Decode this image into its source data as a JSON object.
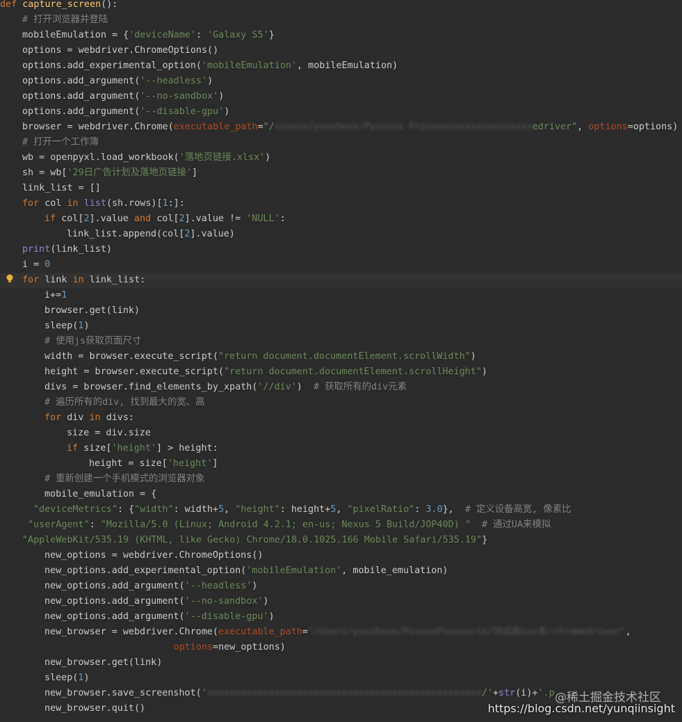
{
  "editor": {
    "lines": [
      {
        "indent": 0,
        "current": false,
        "tokens": [
          {
            "t": "def ",
            "c": "kw"
          },
          {
            "t": "capture_screen",
            "c": "fn"
          },
          {
            "t": "():",
            "c": "plain"
          }
        ]
      },
      {
        "indent": 1,
        "current": false,
        "tokens": [
          {
            "t": "# 打开浏览器并登陆",
            "c": "com"
          }
        ]
      },
      {
        "indent": 1,
        "current": false,
        "tokens": [
          {
            "t": "mobileEmulation = {",
            "c": "plain"
          },
          {
            "t": "'deviceName'",
            "c": "str"
          },
          {
            "t": ": ",
            "c": "plain"
          },
          {
            "t": "'Galaxy S5'",
            "c": "str"
          },
          {
            "t": "}",
            "c": "plain"
          }
        ]
      },
      {
        "indent": 1,
        "current": false,
        "tokens": [
          {
            "t": "options = webdriver.ChromeOptions()",
            "c": "plain"
          }
        ]
      },
      {
        "indent": 1,
        "current": false,
        "tokens": [
          {
            "t": "options.add_experimental_option(",
            "c": "plain"
          },
          {
            "t": "'mobileEmulation'",
            "c": "str"
          },
          {
            "t": ", mobileEmulation)",
            "c": "plain"
          }
        ]
      },
      {
        "indent": 1,
        "current": false,
        "tokens": [
          {
            "t": "options.add_argument(",
            "c": "plain"
          },
          {
            "t": "'--headless'",
            "c": "str"
          },
          {
            "t": ")",
            "c": "plain"
          }
        ]
      },
      {
        "indent": 1,
        "current": false,
        "tokens": [
          {
            "t": "options.add_argument(",
            "c": "plain"
          },
          {
            "t": "'--no-sandbox'",
            "c": "str"
          },
          {
            "t": ")",
            "c": "plain"
          }
        ]
      },
      {
        "indent": 1,
        "current": false,
        "tokens": [
          {
            "t": "options.add_argument(",
            "c": "plain"
          },
          {
            "t": "'--disable-gpu'",
            "c": "str"
          },
          {
            "t": ")",
            "c": "plain"
          }
        ]
      },
      {
        "indent": 1,
        "current": false,
        "tokens": [
          {
            "t": "browser = webdriver.Chrome(",
            "c": "plain"
          },
          {
            "t": "executable_path",
            "c": "param"
          },
          {
            "t": "=",
            "c": "plain"
          },
          {
            "t": "\"/",
            "c": "str"
          },
          {
            "t": "xxxxxx/yxxxhexx/Pyxxxxx Proxxxxxxxxxxxxxxxxxxx",
            "c": "blur"
          },
          {
            "t": "edriver\"",
            "c": "str"
          },
          {
            "t": ", ",
            "c": "plain"
          },
          {
            "t": "options",
            "c": "param"
          },
          {
            "t": "=options)",
            "c": "plain"
          }
        ]
      },
      {
        "indent": 1,
        "current": false,
        "tokens": [
          {
            "t": "# 打开一个工作簿",
            "c": "com"
          }
        ]
      },
      {
        "indent": 1,
        "current": false,
        "tokens": [
          {
            "t": "wb = openpyxl.load_workbook(",
            "c": "plain"
          },
          {
            "t": "'落地页链接.xlsx'",
            "c": "str"
          },
          {
            "t": ")",
            "c": "plain"
          }
        ]
      },
      {
        "indent": 1,
        "current": false,
        "tokens": [
          {
            "t": "sh = wb[",
            "c": "plain"
          },
          {
            "t": "'29日广告计划及落地页链接'",
            "c": "str"
          },
          {
            "t": "]",
            "c": "plain"
          }
        ]
      },
      {
        "indent": 1,
        "current": false,
        "tokens": [
          {
            "t": "link_list = []",
            "c": "plain"
          }
        ]
      },
      {
        "indent": 1,
        "current": false,
        "tokens": [
          {
            "t": "for ",
            "c": "kw"
          },
          {
            "t": "col ",
            "c": "plain"
          },
          {
            "t": "in ",
            "c": "kw"
          },
          {
            "t": "list",
            "c": "builtin"
          },
          {
            "t": "(sh.rows)[",
            "c": "plain"
          },
          {
            "t": "1",
            "c": "num"
          },
          {
            "t": ":]:",
            "c": "plain"
          }
        ]
      },
      {
        "indent": 2,
        "current": false,
        "tokens": [
          {
            "t": "if ",
            "c": "kw"
          },
          {
            "t": "col[",
            "c": "plain"
          },
          {
            "t": "2",
            "c": "num"
          },
          {
            "t": "].value ",
            "c": "plain"
          },
          {
            "t": "and ",
            "c": "kw"
          },
          {
            "t": "col[",
            "c": "plain"
          },
          {
            "t": "2",
            "c": "num"
          },
          {
            "t": "].value != ",
            "c": "plain"
          },
          {
            "t": "'NULL'",
            "c": "str"
          },
          {
            "t": ":",
            "c": "plain"
          }
        ]
      },
      {
        "indent": 3,
        "current": false,
        "tokens": [
          {
            "t": "link_list.append(col[",
            "c": "plain"
          },
          {
            "t": "2",
            "c": "num"
          },
          {
            "t": "].value)",
            "c": "plain"
          }
        ]
      },
      {
        "indent": 1,
        "current": false,
        "tokens": [
          {
            "t": "print",
            "c": "builtin"
          },
          {
            "t": "(link_list)",
            "c": "plain"
          }
        ]
      },
      {
        "indent": 1,
        "current": false,
        "tokens": [
          {
            "t": "i = ",
            "c": "plain"
          },
          {
            "t": "0",
            "c": "num"
          }
        ]
      },
      {
        "indent": 1,
        "current": true,
        "tokens": [
          {
            "t": "for ",
            "c": "kw"
          },
          {
            "t": "link ",
            "c": "plain"
          },
          {
            "t": "in ",
            "c": "kw"
          },
          {
            "t": "link_list:",
            "c": "plain"
          }
        ]
      },
      {
        "indent": 2,
        "current": false,
        "tokens": [
          {
            "t": "i+=",
            "c": "plain"
          },
          {
            "t": "1",
            "c": "num"
          }
        ]
      },
      {
        "indent": 2,
        "current": false,
        "tokens": [
          {
            "t": "browser.get(link)",
            "c": "plain"
          }
        ]
      },
      {
        "indent": 2,
        "current": false,
        "tokens": [
          {
            "t": "sleep(",
            "c": "plain"
          },
          {
            "t": "1",
            "c": "num"
          },
          {
            "t": ")",
            "c": "plain"
          }
        ]
      },
      {
        "indent": 2,
        "current": false,
        "tokens": [
          {
            "t": "# 使用js获取页面尺寸",
            "c": "com"
          }
        ]
      },
      {
        "indent": 2,
        "current": false,
        "tokens": [
          {
            "t": "width = browser.execute_script(",
            "c": "plain"
          },
          {
            "t": "\"return document.documentElement.scrollWidth\"",
            "c": "str"
          },
          {
            "t": ")",
            "c": "plain"
          }
        ]
      },
      {
        "indent": 2,
        "current": false,
        "tokens": [
          {
            "t": "height = browser.execute_script(",
            "c": "plain"
          },
          {
            "t": "\"return document.documentElement.scrollHeight\"",
            "c": "str"
          },
          {
            "t": ")",
            "c": "plain"
          }
        ]
      },
      {
        "indent": 2,
        "current": false,
        "tokens": [
          {
            "t": "divs = browser.find_elements_by_xpath(",
            "c": "plain"
          },
          {
            "t": "'//div'",
            "c": "str"
          },
          {
            "t": ")  ",
            "c": "plain"
          },
          {
            "t": "# 获取所有的div元素",
            "c": "com"
          }
        ]
      },
      {
        "indent": 2,
        "current": false,
        "tokens": [
          {
            "t": "# 遍历所有的div, 找到最大的宽、高",
            "c": "com"
          }
        ]
      },
      {
        "indent": 2,
        "current": false,
        "tokens": [
          {
            "t": "for ",
            "c": "kw"
          },
          {
            "t": "div ",
            "c": "plain"
          },
          {
            "t": "in ",
            "c": "kw"
          },
          {
            "t": "divs:",
            "c": "plain"
          }
        ]
      },
      {
        "indent": 3,
        "current": false,
        "tokens": [
          {
            "t": "size = div.size",
            "c": "plain"
          }
        ]
      },
      {
        "indent": 3,
        "current": false,
        "tokens": [
          {
            "t": "if ",
            "c": "kw"
          },
          {
            "t": "size[",
            "c": "plain"
          },
          {
            "t": "'height'",
            "c": "str"
          },
          {
            "t": "] > height:",
            "c": "plain"
          }
        ]
      },
      {
        "indent": 4,
        "current": false,
        "tokens": [
          {
            "t": "height = size[",
            "c": "plain"
          },
          {
            "t": "'height'",
            "c": "str"
          },
          {
            "t": "]",
            "c": "plain"
          }
        ]
      },
      {
        "indent": 2,
        "current": false,
        "tokens": [
          {
            "t": "# 重新创建一个手机模式的浏览器对象",
            "c": "com"
          }
        ]
      },
      {
        "indent": 2,
        "current": false,
        "tokens": [
          {
            "t": "mobile_emulation = {",
            "c": "plain"
          }
        ]
      },
      {
        "indent": 1.5,
        "current": false,
        "tokens": [
          {
            "t": "\"deviceMetrics\"",
            "c": "str"
          },
          {
            "t": ": {",
            "c": "plain"
          },
          {
            "t": "\"width\"",
            "c": "str"
          },
          {
            "t": ": width+",
            "c": "plain"
          },
          {
            "t": "5",
            "c": "num"
          },
          {
            "t": ", ",
            "c": "plain"
          },
          {
            "t": "\"height\"",
            "c": "str"
          },
          {
            "t": ": height+",
            "c": "plain"
          },
          {
            "t": "5",
            "c": "num"
          },
          {
            "t": ", ",
            "c": "plain"
          },
          {
            "t": "\"pixelRatio\"",
            "c": "str"
          },
          {
            "t": ": ",
            "c": "plain"
          },
          {
            "t": "3.0",
            "c": "num"
          },
          {
            "t": "},  ",
            "c": "plain"
          },
          {
            "t": "# 定义设备高宽, 像素比",
            "c": "com"
          }
        ]
      },
      {
        "indent": 1.25,
        "current": false,
        "tokens": [
          {
            "t": "\"userAgent\"",
            "c": "str"
          },
          {
            "t": ": ",
            "c": "plain"
          },
          {
            "t": "\"Mozilla/5.0 (Linux; Android 4.2.1; en-us; Nexus 5 Build/JOP40D) \"",
            "c": "str"
          },
          {
            "t": "  ",
            "c": "plain"
          },
          {
            "t": "# 通过UA来模拟",
            "c": "com"
          }
        ]
      },
      {
        "indent": 1,
        "current": false,
        "tokens": [
          {
            "t": "\"AppleWebKit/535.19 (KHTML, like Gecko) Chrome/18.0.1025.166 Mobile Safari/535.19\"",
            "c": "str"
          },
          {
            "t": "}",
            "c": "plain"
          }
        ]
      },
      {
        "indent": 2,
        "current": false,
        "tokens": [
          {
            "t": "new_options = webdriver.ChromeOptions()",
            "c": "plain"
          }
        ]
      },
      {
        "indent": 2,
        "current": false,
        "tokens": [
          {
            "t": "new_options.add_experimental_option(",
            "c": "plain"
          },
          {
            "t": "'mobileEmulation'",
            "c": "str"
          },
          {
            "t": ", mobile_emulation)",
            "c": "plain"
          }
        ]
      },
      {
        "indent": 2,
        "current": false,
        "tokens": [
          {
            "t": "new_options.add_argument(",
            "c": "plain"
          },
          {
            "t": "'--headless'",
            "c": "str"
          },
          {
            "t": ")",
            "c": "plain"
          }
        ]
      },
      {
        "indent": 2,
        "current": false,
        "tokens": [
          {
            "t": "new_options.add_argument(",
            "c": "plain"
          },
          {
            "t": "'--no-sandbox'",
            "c": "str"
          },
          {
            "t": ")",
            "c": "plain"
          }
        ]
      },
      {
        "indent": 2,
        "current": false,
        "tokens": [
          {
            "t": "new_options.add_argument(",
            "c": "plain"
          },
          {
            "t": "'--disable-gpu'",
            "c": "str"
          },
          {
            "t": ")",
            "c": "plain"
          }
        ]
      },
      {
        "indent": 2,
        "current": false,
        "tokens": [
          {
            "t": "new_browser = webdriver.Chrome(",
            "c": "plain"
          },
          {
            "t": "executable_path",
            "c": "param"
          },
          {
            "t": "=",
            "c": "plain"
          },
          {
            "t": "\"/Users/yxxzhxxx/PxxxxxPxxxxxcts/测试用xxx本/chromedriver\"",
            "c": "blur"
          },
          {
            "t": ",",
            "c": "plain"
          }
        ]
      },
      {
        "indent": 7.8,
        "current": false,
        "tokens": [
          {
            "t": "options",
            "c": "param"
          },
          {
            "t": "=new_options)",
            "c": "plain"
          }
        ]
      },
      {
        "indent": 2,
        "current": false,
        "tokens": [
          {
            "t": "new_browser.get(link)",
            "c": "plain"
          }
        ]
      },
      {
        "indent": 2,
        "current": false,
        "tokens": [
          {
            "t": "sleep(",
            "c": "plain"
          },
          {
            "t": "1",
            "c": "num"
          },
          {
            "t": ")",
            "c": "plain"
          }
        ]
      },
      {
        "indent": 2,
        "current": false,
        "tokens": [
          {
            "t": "new_browser.save_screenshot(",
            "c": "plain"
          },
          {
            "t": "'",
            "c": "str"
          },
          {
            "t": "xxxxxxxxxxxxxxxxxxxxxxxxxxxxxxxxxxxxxxxxxxxxxxxxx",
            "c": "blur"
          },
          {
            "t": "/'",
            "c": "str"
          },
          {
            "t": "+",
            "c": "plain"
          },
          {
            "t": "str",
            "c": "builtin"
          },
          {
            "t": "(i)+",
            "c": "plain"
          },
          {
            "t": "'.p",
            "c": "str"
          }
        ]
      },
      {
        "indent": 2,
        "current": false,
        "tokens": [
          {
            "t": "new_browser.quit()",
            "c": "plain"
          }
        ]
      }
    ]
  },
  "watermark": "@稀土掘金技术社区",
  "footer_url": "https://blog.csdn.net/yunqiinsight",
  "gutter_icon": "lightbulb-icon",
  "colors": {
    "background": "#2b2b2b",
    "keyword": "#cc7832",
    "string": "#6a8759",
    "comment": "#808080"
  }
}
